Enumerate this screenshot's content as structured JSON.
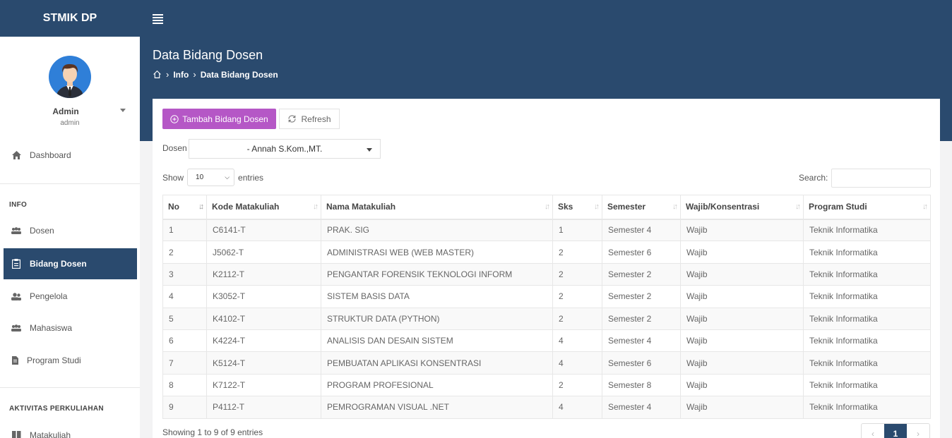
{
  "app": {
    "brand": "STMIK DP"
  },
  "header": {
    "title": "Data Bidang Dosen",
    "breadcrumb": [
      "Info",
      "Data Bidang Dosen"
    ]
  },
  "user": {
    "name": "Admin",
    "role": "admin"
  },
  "sidebar": {
    "dashboard": "Dashboard",
    "section_info": "INFO",
    "items_info": [
      "Dosen",
      "Bidang Dosen",
      "Pengelola",
      "Mahasiswa",
      "Program Studi"
    ],
    "active": "Bidang Dosen",
    "section_aktivitas": "AKTIVITAS PERKULIAHAN",
    "items_aktivitas": [
      "Matakuliah"
    ]
  },
  "toolbar": {
    "add_label": "Tambah Bidang Dosen",
    "refresh_label": "Refresh",
    "add_color": "#b557c6"
  },
  "filter": {
    "label": "Dosen",
    "selected": "- Annah S.Kom.,MT."
  },
  "table_controls": {
    "show_label": "Show",
    "page_length": "10",
    "entries_label": "entries",
    "search_label": "Search:",
    "search_value": ""
  },
  "table": {
    "columns": [
      "No",
      "Kode Matakuliah",
      "Nama Matakuliah",
      "Sks",
      "Semester",
      "Wajib/Konsentrasi",
      "Program Studi"
    ],
    "rows": [
      [
        "1",
        "C6141-T",
        "PRAK. SIG",
        "1",
        "Semester 4",
        "Wajib",
        "Teknik Informatika"
      ],
      [
        "2",
        "J5062-T",
        "ADMINISTRASI WEB (WEB MASTER)",
        "2",
        "Semester 6",
        "Wajib",
        "Teknik Informatika"
      ],
      [
        "3",
        "K2112-T",
        "PENGANTAR FORENSIK TEKNOLOGI INFORM",
        "2",
        "Semester 2",
        "Wajib",
        "Teknik Informatika"
      ],
      [
        "4",
        "K3052-T",
        "SISTEM BASIS DATA",
        "2",
        "Semester 2",
        "Wajib",
        "Teknik Informatika"
      ],
      [
        "5",
        "K4102-T",
        "STRUKTUR DATA (PYTHON)",
        "2",
        "Semester 2",
        "Wajib",
        "Teknik Informatika"
      ],
      [
        "6",
        "K4224-T",
        "ANALISIS DAN DESAIN SISTEM",
        "4",
        "Semester 4",
        "Wajib",
        "Teknik Informatika"
      ],
      [
        "7",
        "K5124-T",
        "PEMBUATAN APLIKASI KONSENTRASI",
        "4",
        "Semester 6",
        "Wajib",
        "Teknik Informatika"
      ],
      [
        "8",
        "K7122-T",
        "PROGRAM PROFESIONAL",
        "2",
        "Semester 8",
        "Wajib",
        "Teknik Informatika"
      ],
      [
        "9",
        "P4112-T",
        "PEMROGRAMAN VISUAL .NET",
        "4",
        "Semester 4",
        "Wajib",
        "Teknik Informatika"
      ]
    ]
  },
  "footer": {
    "info": "Showing 1 to 9 of 9 entries",
    "pages": [
      "‹",
      "1",
      "›"
    ],
    "current_page": "1"
  },
  "colors": {
    "primary": "#2a4a6e",
    "accent": "#b557c6"
  }
}
